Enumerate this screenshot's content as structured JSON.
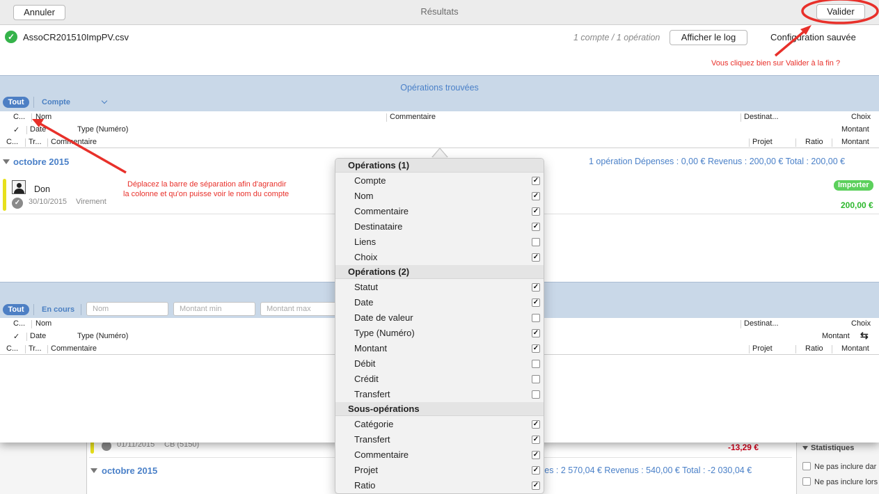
{
  "window": {
    "title": "Résultats",
    "cancel_label": "Annuler",
    "validate_label": "Valider"
  },
  "file": {
    "name": "AssoCR201510ImpPV.csv",
    "count": "1 compte / 1 opération",
    "log_button": "Afficher le log",
    "status": "Configuration sauvée"
  },
  "annotations": {
    "validate_hint": "Vous cliquez bien sur Valider à la fin ?",
    "separator_hint_1": "Déplacez la barre de séparation afin d'agrandir",
    "separator_hint_2": "la colonne et qu'on puisse voir le nom du compte",
    "color": "#e8302a"
  },
  "found": {
    "title": "Opérations trouvées",
    "all_label": "Tout",
    "compte_label": "Compte",
    "columns": {
      "c": "C...",
      "nom": "Nom",
      "commentaire": "Commentaire",
      "destinataire": "Destinat...",
      "choix": "Choix",
      "check": "✓",
      "date": "Date",
      "type": "Type (Numéro)",
      "montant": "Montant",
      "c2": "C...",
      "tr": "Tr...",
      "commentaire2": "Commentaire",
      "projet": "Projet",
      "ratio": "Ratio",
      "montant2": "Montant"
    },
    "month": {
      "name": "octobre 2015",
      "summary": "1 opération   Dépenses : 0,00 €   Revenus : 200,00 €   Total : 200,00 €"
    },
    "operation": {
      "name": "Don",
      "date": "30/10/2015",
      "type": "Virement",
      "badge": "Importer",
      "amount": "200,00 €"
    }
  },
  "existing": {
    "all_label": "Tout",
    "current_label": "En cours",
    "filters": {
      "name_placeholder": "Nom",
      "min_placeholder": "Montant min",
      "max_placeholder": "Montant max"
    },
    "columns": {
      "c": "C...",
      "nom": "Nom",
      "destinataire": "Destinat...",
      "choix": "Choix",
      "check": "✓",
      "date": "Date",
      "type": "Type (Numéro)",
      "montant": "Montant",
      "swap_icon": "⇆",
      "c2": "C...",
      "tr": "Tr...",
      "commentaire": "Commentaire",
      "projet": "Projet",
      "ratio": "Ratio",
      "montant2": "Montant"
    }
  },
  "background": {
    "row": {
      "date": "01/11/2015",
      "type": "CB (5150)",
      "amount": "-13,29 €"
    },
    "month": {
      "name": "octobre 2015",
      "summary": "ses : 2 570,04 €   Revenus : 540,00 €   Total : -2 030,04 €"
    },
    "stats": {
      "header": "Statistiques",
      "item1": "Ne pas inclure dar",
      "item2": "Ne pas inclure lors"
    }
  },
  "menu": {
    "sections": [
      {
        "title": "Opérations (1)",
        "items": [
          {
            "label": "Compte",
            "checked": true
          },
          {
            "label": "Nom",
            "checked": true
          },
          {
            "label": "Commentaire",
            "checked": true
          },
          {
            "label": "Destinataire",
            "checked": true
          },
          {
            "label": "Liens",
            "checked": false
          },
          {
            "label": "Choix",
            "checked": true
          }
        ]
      },
      {
        "title": "Opérations (2)",
        "items": [
          {
            "label": "Statut",
            "checked": true
          },
          {
            "label": "Date",
            "checked": true
          },
          {
            "label": "Date de valeur",
            "checked": false
          },
          {
            "label": "Type (Numéro)",
            "checked": true
          },
          {
            "label": "Montant",
            "checked": true
          },
          {
            "label": "Débit",
            "checked": false
          },
          {
            "label": "Crédit",
            "checked": false
          },
          {
            "label": "Transfert",
            "checked": false
          }
        ]
      },
      {
        "title": "Sous-opérations",
        "items": [
          {
            "label": "Catégorie",
            "checked": true
          },
          {
            "label": "Transfert",
            "checked": true
          },
          {
            "label": "Commentaire",
            "checked": true
          },
          {
            "label": "Projet",
            "checked": true
          },
          {
            "label": "Ratio",
            "checked": true
          }
        ]
      }
    ]
  },
  "colors": {
    "accent": "#4a80c8",
    "section_bg": "#c9d8e8",
    "positive": "#2db82d",
    "negative": "#d0021b",
    "badge": "#5cd05c"
  }
}
